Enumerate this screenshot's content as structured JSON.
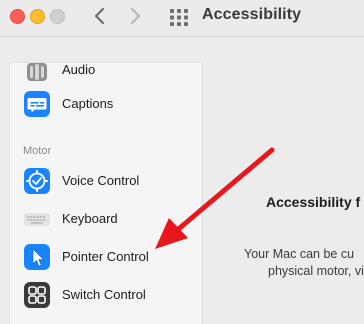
{
  "window": {
    "title": "Accessibility"
  },
  "sidebar": {
    "items": [
      {
        "label": "Audio",
        "icon": "speaker-icon"
      },
      {
        "label": "Captions",
        "icon": "captions-icon"
      },
      {
        "label": "Voice Control",
        "icon": "voice-control-icon"
      },
      {
        "label": "Keyboard",
        "icon": "keyboard-icon"
      },
      {
        "label": "Pointer Control",
        "icon": "pointer-icon"
      },
      {
        "label": "Switch Control",
        "icon": "switch-control-icon"
      }
    ],
    "section_motor": "Motor"
  },
  "content": {
    "title": "Accessibility f",
    "text_line1": "Your Mac can be cu",
    "text_line2": "physical motor, vi"
  },
  "annotation": {
    "arrow_color": "#e8171c"
  },
  "colors": {
    "accent_blue": "#1a84ff",
    "dark_icon": "#3a3a3a"
  }
}
